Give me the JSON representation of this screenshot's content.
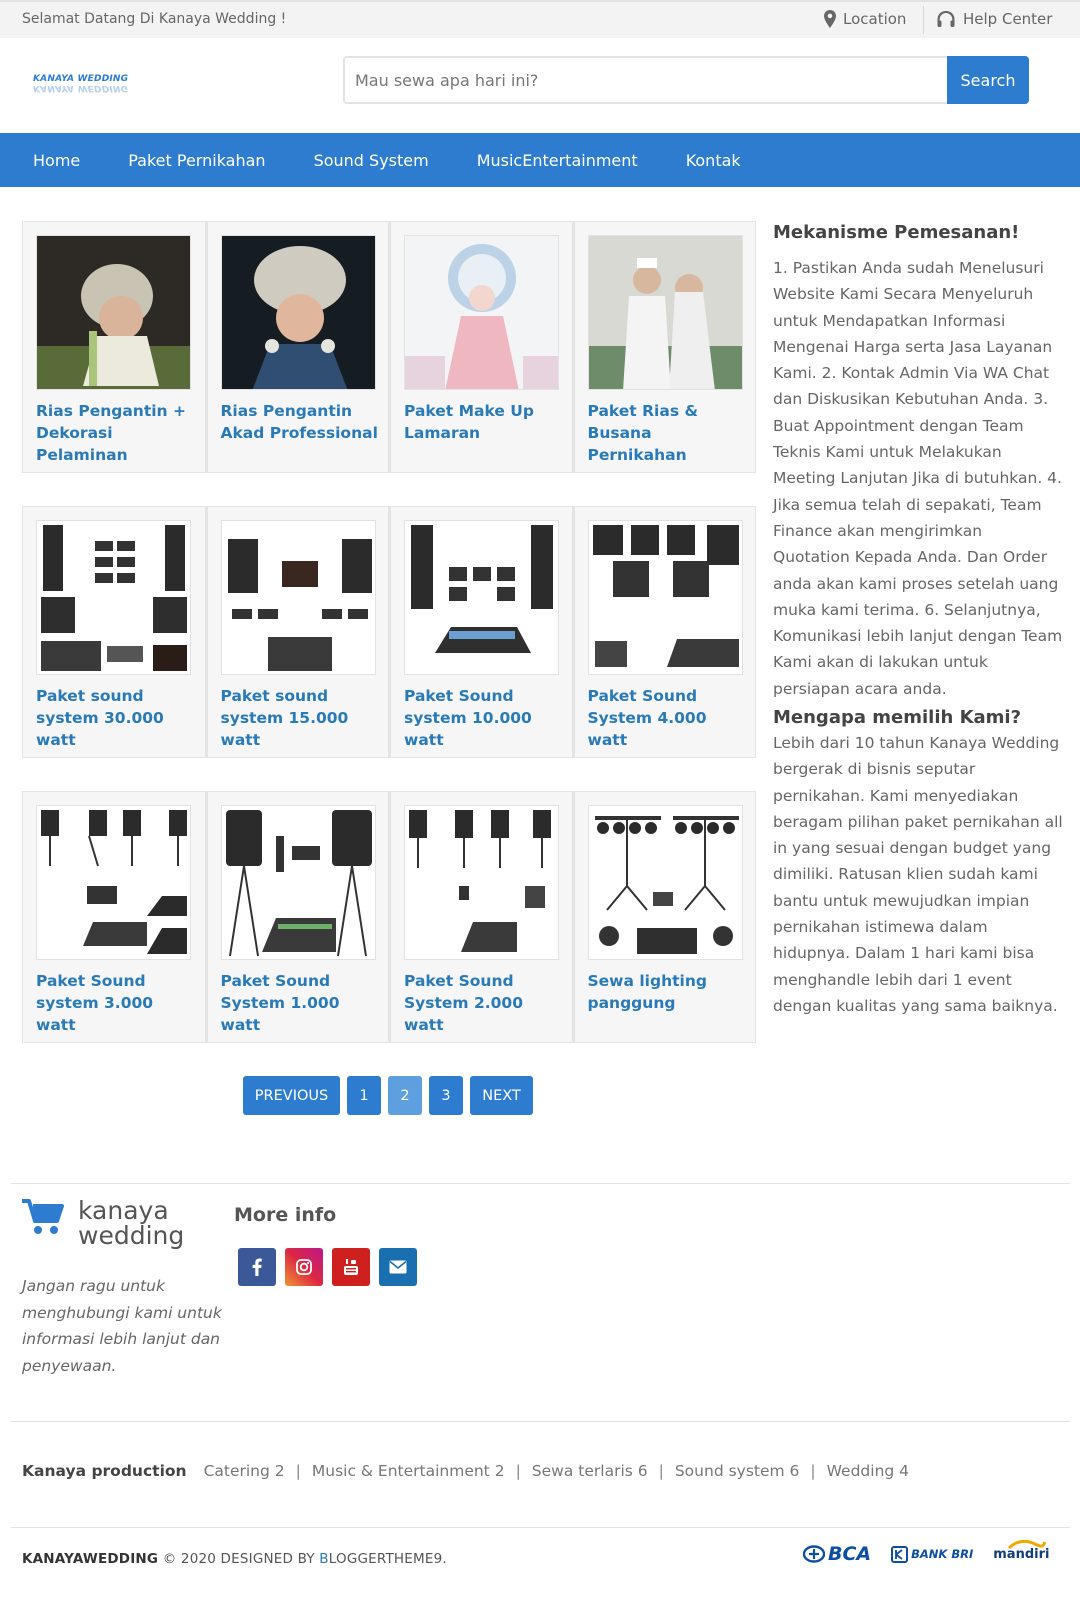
{
  "topbar": {
    "welcome": "Selamat Datang Di Kanaya Wedding !",
    "location": "Location",
    "help_center": "Help Center"
  },
  "header": {
    "logo_text": "KANAYA WEDDING",
    "search_placeholder": "Mau sewa apa hari ini?",
    "search_button": "Search"
  },
  "nav": {
    "items": [
      "Home",
      "Paket Pernikahan",
      "Sound System",
      "MusicEntertainment",
      "Kontak"
    ]
  },
  "products": [
    {
      "title": "Rias Pengantin + Dekorasi Pelaminan",
      "image": "bride-photo"
    },
    {
      "title": "Rias Pengantin Akad Professional",
      "image": "bride-photo"
    },
    {
      "title": "Paket Make Up Lamaran",
      "image": "bride-photo"
    },
    {
      "title": "Paket Rias & Busana Pernikahan",
      "image": "couple-photo"
    },
    {
      "title": "Paket sound system 30.000 watt",
      "image": "sound-system-photo"
    },
    {
      "title": "Paket sound system 15.000 watt",
      "image": "sound-system-photo"
    },
    {
      "title": "Paket Sound system 10.000 watt",
      "image": "sound-system-photo"
    },
    {
      "title": "Paket Sound System 4.000 watt",
      "image": "sound-system-photo"
    },
    {
      "title": "Paket Sound system 3.000 watt",
      "image": "sound-system-photo"
    },
    {
      "title": "Paket Sound System 1.000 watt",
      "image": "sound-system-photo"
    },
    {
      "title": "Paket Sound System 2.000 watt",
      "image": "sound-system-photo"
    },
    {
      "title": "Sewa lighting panggung",
      "image": "lighting-photo"
    }
  ],
  "pagination": {
    "previous": "PREVIOUS",
    "pages": [
      "1",
      "2",
      "3"
    ],
    "current": "2",
    "next": "NEXT"
  },
  "sidebar": {
    "section1_title": "Mekanisme Pemesanan!",
    "section1_text": "1. Pastikan Anda sudah Menelusuri Website Kami Secara Menyeluruh untuk Mendapatkan Informasi Mengenai Harga serta Jasa Layanan Kami. 2. Kontak Admin Via WA Chat dan Diskusikan Kebutuhan Anda. 3. Buat Appointment dengan Team Teknis Kami untuk Melakukan Meeting Lanjutan Jika di butuhkan. 4. Jika semua telah di sepakati, Team Finance akan mengirimkan Quotation Kepada Anda. Dan Order anda akan kami proses setelah uang muka kami terima. 6. Selanjutnya, Komunikasi lebih lanjut dengan Team Kami akan di lakukan untuk persiapan acara anda.",
    "section2_title": "Mengapa memilih Kami?",
    "section2_text": "Lebih dari 10 tahun Kanaya Wedding bergerak di bisnis seputar pernikahan. Kami menyediakan beragam pilihan paket pernikahan all in yang sesuai dengan budget yang dimiliki. Ratusan klien sudah kami bantu untuk mewujudkan impian pernikahan istimewa dalam hidupnya. Dalam 1 hari kami bisa menghandle lebih dari 1 event dengan kualitas yang sama baiknya."
  },
  "footer": {
    "brand_line1": "kanaya",
    "brand_line2": "wedding",
    "description": "Jangan ragu untuk menghubungi kami untuk informasi lebih lanjut dan penyewaan.",
    "more_info": "More info",
    "socials": [
      {
        "icon": "facebook-icon",
        "color": "#3b5998"
      },
      {
        "icon": "instagram-icon",
        "color": "#c13584"
      },
      {
        "icon": "youtube-icon",
        "color": "#cd201f"
      },
      {
        "icon": "email-icon",
        "color": "#1a6fb0"
      }
    ],
    "labels_title": "Kanaya production",
    "labels": [
      "Catering 2",
      "Music & Entertainment 2",
      "Sewa terlaris 6",
      "Sound system 6",
      "Wedding 4"
    ],
    "copyright_brand": "KANAYAWEDDING",
    "copyright_text": "© 2020 DESIGNED BY",
    "designer_initial": "B",
    "designer_rest": "LOGGERTHEME9",
    "copyright_end": ".",
    "banks": [
      "BCA",
      "BANK BRI",
      "mandiri"
    ]
  },
  "colors": {
    "accent": "#2d7cd0",
    "link": "#2a7ab8",
    "current_page": "#5e9fe0"
  }
}
